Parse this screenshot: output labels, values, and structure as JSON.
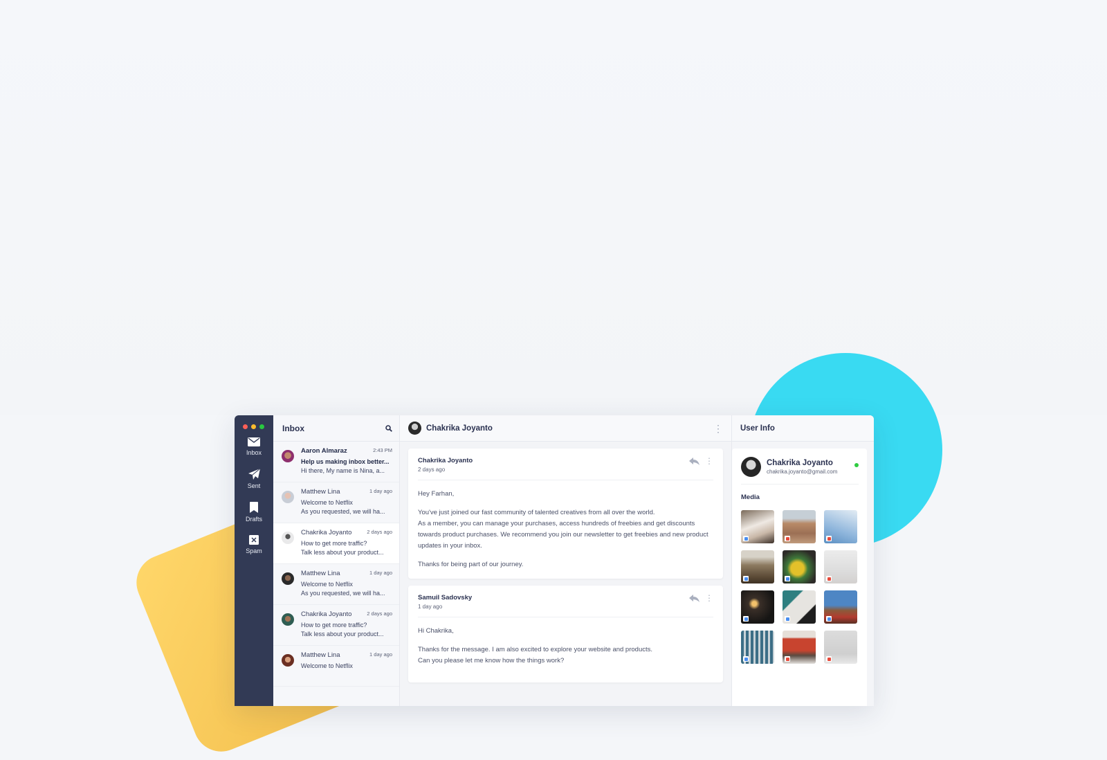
{
  "window": {
    "traffic_lights": {
      "close": "#ff5f57",
      "minimize": "#febc2e",
      "zoom": "#28c840"
    }
  },
  "sidebar": {
    "bg": "#323a55",
    "items": [
      {
        "label": "Inbox",
        "icon": "mail-icon"
      },
      {
        "label": "Sent",
        "icon": "send-icon"
      },
      {
        "label": "Drafts",
        "icon": "bookmark-icon"
      },
      {
        "label": "Spam",
        "icon": "spam-icon"
      }
    ]
  },
  "inbox": {
    "title": "Inbox",
    "messages": [
      {
        "sender": "Aaron Almaraz",
        "time": "2:43 PM",
        "subject": "Help us making inbox better...",
        "preview": "Hi there, My name is Nina, a...",
        "unread": true
      },
      {
        "sender": "Matthew Lina",
        "time": "1 day ago",
        "subject": "Welcome to Netflix",
        "preview": "As you requested, we will ha..."
      },
      {
        "sender": "Chakrika Joyanto",
        "time": "2 days ago",
        "subject": "How to get more traffic?",
        "preview": "Talk less about your product...",
        "active": true
      },
      {
        "sender": "Matthew Lina",
        "time": "1 day ago",
        "subject": "Welcome to Netflix",
        "preview": "As you requested, we will ha..."
      },
      {
        "sender": "Chakrika Joyanto",
        "time": "2 days ago",
        "subject": "How to get more traffic?",
        "preview": "Talk less about your product..."
      },
      {
        "sender": "Matthew Lina",
        "time": "1 day ago",
        "subject": "Welcome to Netflix",
        "preview": ""
      }
    ]
  },
  "conversation": {
    "contact": "Chakrika Joyanto",
    "emails": [
      {
        "from": "Chakrika Joyanto",
        "ago": "2 days ago",
        "greeting": "Hey Farhan,",
        "para1": "You've just joined our fast community of talented creatives from all over the world.",
        "para2": "As a member, you can manage your purchases, access hundreds of freebies and get discounts towards product purchases. We recommend you join our newsletter to get freebies and new product updates in your inbox.",
        "closing": "Thanks for being part of our journey."
      },
      {
        "from": "Samuil Sadovsky",
        "ago": "1 day ago",
        "greeting": "Hi Chakrika,",
        "para1": "Thanks for the message. I am also excited to explore your website and products.",
        "para2": "Can you please let me know how the things work?"
      }
    ]
  },
  "user_info": {
    "title": "User Info",
    "name": "Chakrika Joyanto",
    "email": "chakrika.joyanto@gmail.com",
    "status_color": "#2ecc40",
    "media_title": "Media",
    "media": [
      {
        "type": "image"
      },
      {
        "type": "pdf"
      },
      {
        "type": "pdf"
      },
      {
        "type": "image"
      },
      {
        "type": "video"
      },
      {
        "type": "pdf"
      },
      {
        "type": "video"
      },
      {
        "type": "image"
      },
      {
        "type": "video"
      },
      {
        "type": "image"
      },
      {
        "type": "pdf"
      },
      {
        "type": "pdf"
      }
    ]
  }
}
